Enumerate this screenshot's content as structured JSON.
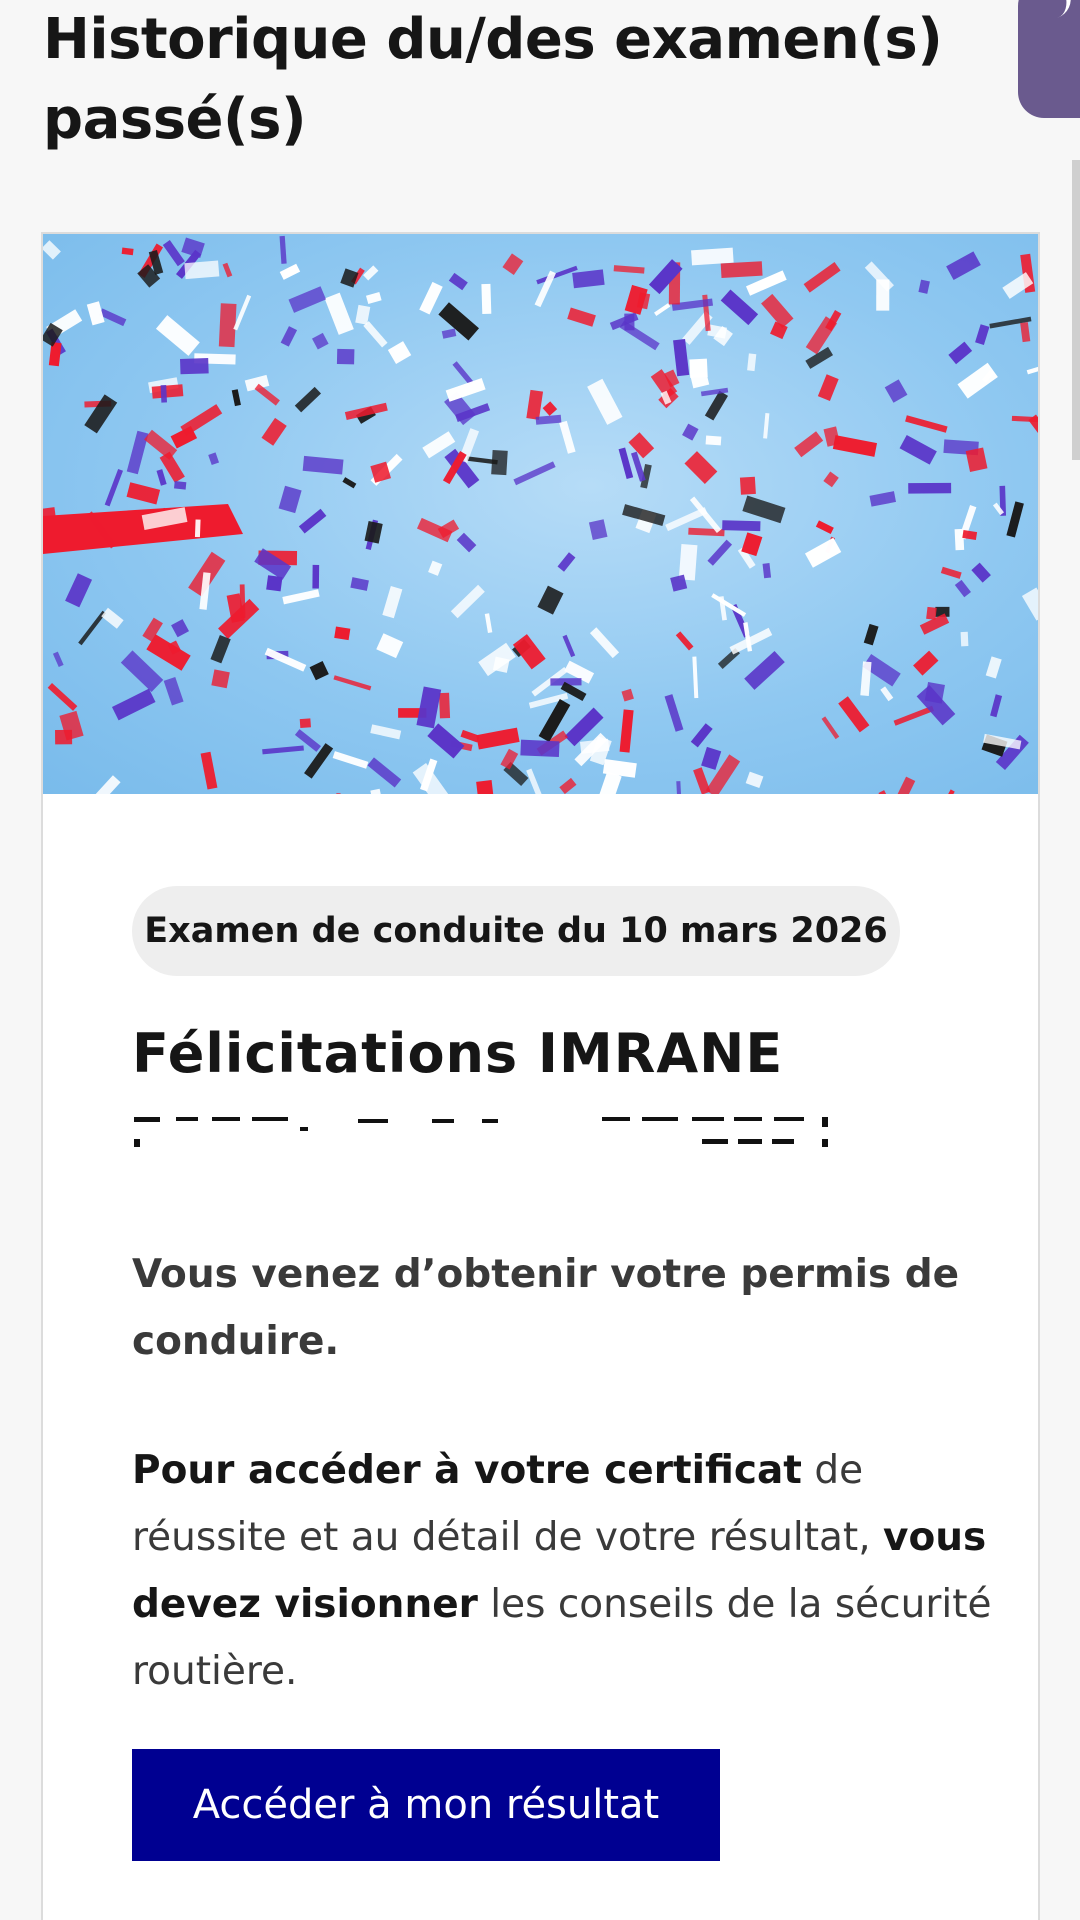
{
  "page": {
    "title": "Historique du/des examen(s) passé(s)"
  },
  "hero": {
    "icon": "confetti-image",
    "colors": {
      "sky": "#8fc8f1",
      "red": "#ee1b2e",
      "blue": "#5a35c8",
      "white": "#ffffff",
      "black": "#1a1a1a"
    }
  },
  "card": {
    "exam_tag": "Examen de conduite du 10 mars 2026",
    "congrats": "Félicitations IMRANE",
    "paragraph_1": "Vous venez d’obtenir votre permis de conduire.",
    "paragraph_2": {
      "part_1": "Pour accéder à votre certificat",
      "part_2": " de réussite et au détail de votre résultat, ",
      "part_3": "vous devez visionner",
      "part_4": " les conseils de la sécurité routière."
    },
    "cta_label": "Accéder à mon résultat"
  },
  "theme": {
    "accent": "#000091",
    "tag_background": "#eeeeee"
  }
}
